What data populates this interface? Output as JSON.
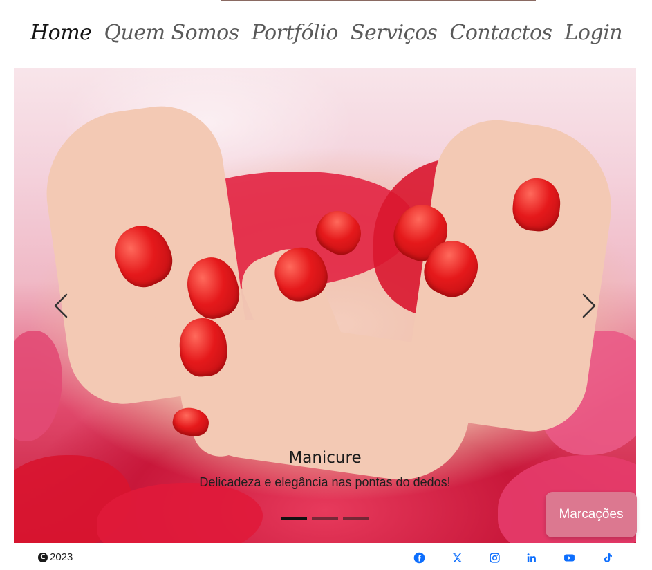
{
  "nav": {
    "items": [
      {
        "label": "Home",
        "active": true
      },
      {
        "label": "Quem Somos",
        "active": false
      },
      {
        "label": "Portfólio",
        "active": false
      },
      {
        "label": "Serviços",
        "active": false
      },
      {
        "label": "Contactos",
        "active": false
      },
      {
        "label": "Login",
        "active": false
      }
    ]
  },
  "carousel": {
    "active_index": 0,
    "slide_count": 3,
    "caption_title": "Manicure",
    "caption_text": "Delicadeza e elegância nas pontas do dedos!",
    "prev_icon": "chevron-left-icon",
    "next_icon": "chevron-right-icon"
  },
  "booking_button": {
    "label": "Marcações",
    "color": "#dc7890"
  },
  "footer": {
    "copyright_year": "2023",
    "copyright_icon": "copyright-icon",
    "social_icons": [
      "facebook-icon",
      "x-twitter-icon",
      "instagram-icon",
      "linkedin-icon",
      "youtube-icon",
      "tiktok-icon"
    ],
    "icon_color": "#0d6efd"
  }
}
